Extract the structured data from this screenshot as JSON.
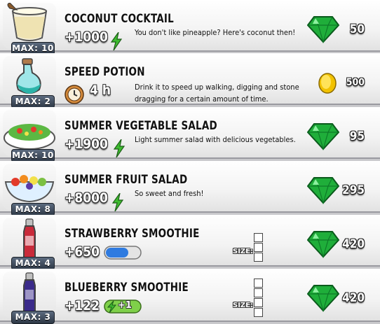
{
  "items": [
    {
      "title": "COCONUT COCKTAIL",
      "max": "MAX: 10",
      "bonus": "+1000",
      "description": "You don't like pineapple? Here's coconut then!",
      "price": "50",
      "currency_icon": "gem-icon",
      "bonus_icon": "energy-icon",
      "image_icon": "coconut-cocktail-icon"
    },
    {
      "title": "SPEED POTION",
      "max": "MAX: 2",
      "duration": "4 h",
      "description": "Drink it to speed up walking, digging and stone dragging for a certain amount of time.",
      "price": "500",
      "currency_icon": "coin-icon",
      "bonus_icon": "clock-icon",
      "image_icon": "speed-potion-icon"
    },
    {
      "title": "SUMMER VEGETABLE SALAD",
      "max": "MAX: 10",
      "bonus": "+1900",
      "description": "Light summer salad with delicious vegetables.",
      "price": "95",
      "currency_icon": "gem-icon",
      "bonus_icon": "energy-icon",
      "image_icon": "vegetable-salad-icon"
    },
    {
      "title": "SUMMER FRUIT SALAD",
      "max": "MAX: 8",
      "bonus": "+8000",
      "description": "So sweet and fresh!",
      "price": "295",
      "currency_icon": "gem-icon",
      "bonus_icon": "energy-icon",
      "image_icon": "fruit-salad-icon"
    },
    {
      "title": "STRAWBERRY SMOOTHIE",
      "max": "MAX: 4",
      "bonus": "+650",
      "size_label": "SIZE:",
      "price": "420",
      "currency_icon": "gem-icon",
      "bonus_icon": "energy-bar-icon",
      "image_icon": "strawberry-smoothie-icon"
    },
    {
      "title": "BLUEBERRY SMOOTHIE",
      "max": "MAX: 3",
      "bonus": "+122",
      "badge_value": "+1",
      "size_label": "SIZE:",
      "price": "420",
      "currency_icon": "gem-icon",
      "bonus_icon": "max-energy-icon",
      "image_icon": "blueberry-smoothie-icon"
    }
  ],
  "colors": {
    "gem": "#1fae3a",
    "energy": "#3dbb2f",
    "coin": "#f2c200",
    "badge": "#3b4656"
  }
}
